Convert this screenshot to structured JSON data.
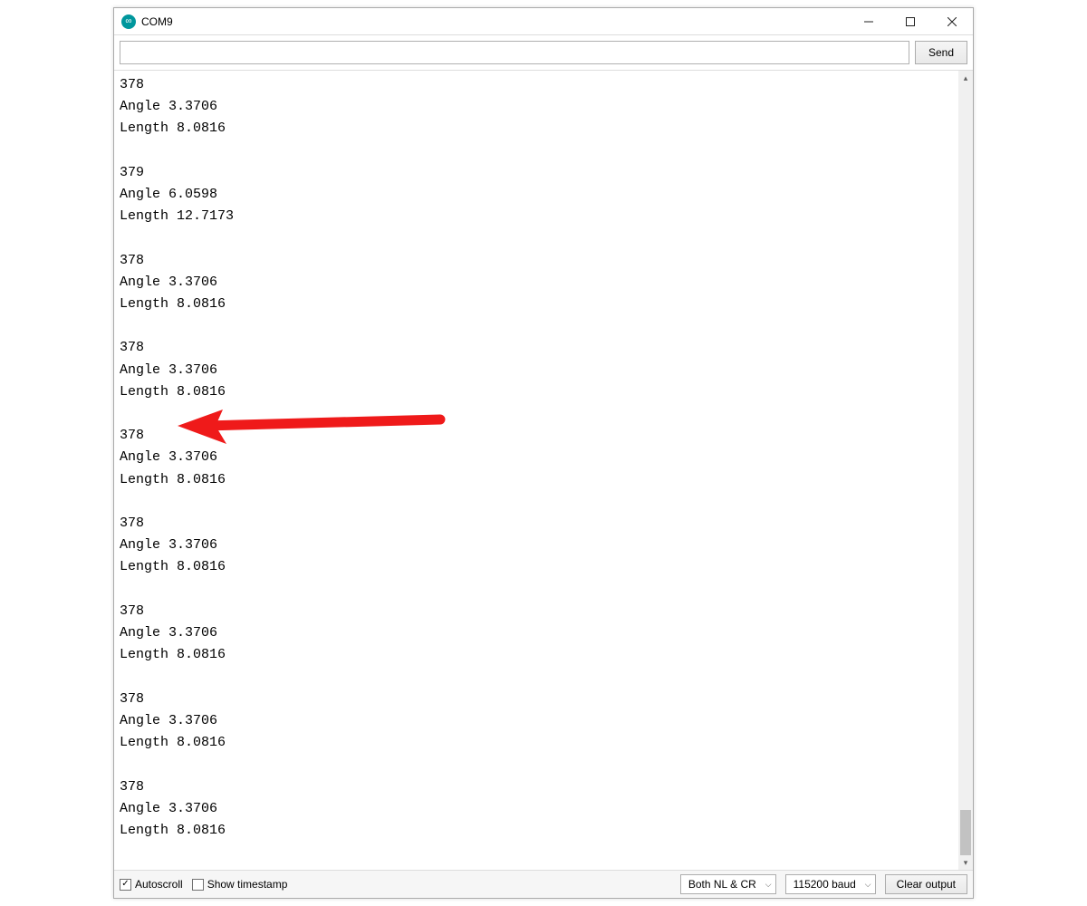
{
  "window": {
    "title": "COM9"
  },
  "toolbar": {
    "command_value": "",
    "send_label": "Send"
  },
  "output_lines": [
    "378",
    "Angle 3.3706",
    "Length 8.0816",
    "",
    "379",
    "Angle 6.0598",
    "Length 12.7173",
    "",
    "378",
    "Angle 3.3706",
    "Length 8.0816",
    "",
    "378",
    "Angle 3.3706",
    "Length 8.0816",
    "",
    "378",
    "Angle 3.3706",
    "Length 8.0816",
    "",
    "378",
    "Angle 3.3706",
    "Length 8.0816",
    "",
    "378",
    "Angle 3.3706",
    "Length 8.0816",
    "",
    "378",
    "Angle 3.3706",
    "Length 8.0816",
    "",
    "378",
    "Angle 3.3706",
    "Length 8.0816",
    ""
  ],
  "footer": {
    "autoscroll_label": "Autoscroll",
    "autoscroll_checked": true,
    "timestamp_label": "Show timestamp",
    "timestamp_checked": false,
    "line_ending": "Both NL & CR",
    "baud": "115200 baud",
    "clear_label": "Clear output"
  },
  "annotation": {
    "kind": "arrow",
    "color": "#ef1a1a"
  }
}
